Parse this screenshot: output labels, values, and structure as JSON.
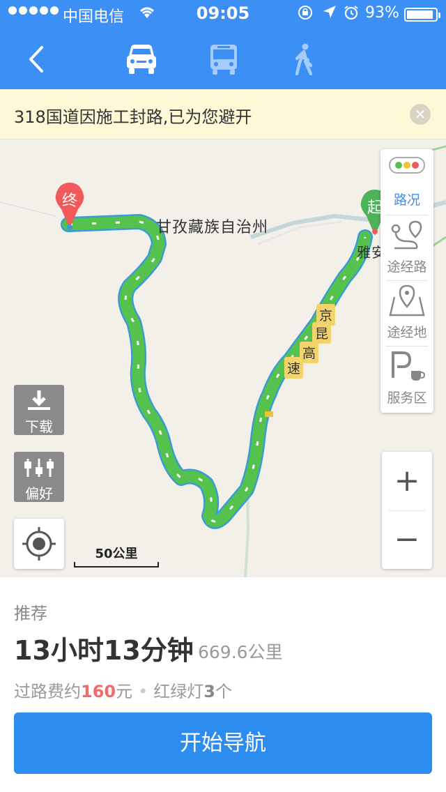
{
  "status_bar": {
    "carrier": "中国电信",
    "time": "09:05",
    "battery_text": "93%",
    "battery_level": 0.93
  },
  "header": {
    "icons": [
      "back-arrow-icon",
      "car-icon",
      "bus-icon",
      "walk-icon"
    ],
    "active_mode": "car"
  },
  "notice": {
    "text": "318国道因施工封路,已为您避开",
    "close_icon": "close-icon"
  },
  "map": {
    "labels": {
      "region": "甘孜藏族自治州",
      "city": "雅安",
      "highway": [
        "京",
        "昆",
        "高",
        "速"
      ]
    },
    "pins": {
      "end": "终",
      "start": "起"
    },
    "buttons": {
      "download": "下载",
      "preference": "偏好"
    },
    "scale": "50公里",
    "side_panel": [
      {
        "label": "路况",
        "icon": "traffic-light-icon",
        "active": true
      },
      {
        "label": "途经路",
        "icon": "route-waypoint-icon",
        "active": false
      },
      {
        "label": "途经地",
        "icon": "map-pin-icon",
        "active": false
      },
      {
        "label": "服务区",
        "icon": "service-area-icon",
        "active": false
      }
    ],
    "zoom": {
      "in": "+",
      "out": "−"
    },
    "colors": {
      "route": "#56c24e",
      "route_edge": "#3a9bd6",
      "accent": "#3b8ff5"
    }
  },
  "route_info": {
    "label": "推荐",
    "duration": "13小时13分钟",
    "distance": "669.6公里",
    "toll_prefix": "过路费约",
    "toll_amount": "160",
    "toll_suffix": "元",
    "lights_prefix": "红绿灯",
    "lights_count": "3",
    "lights_suffix": "个"
  },
  "actions": {
    "start_navigation": "开始导航"
  }
}
